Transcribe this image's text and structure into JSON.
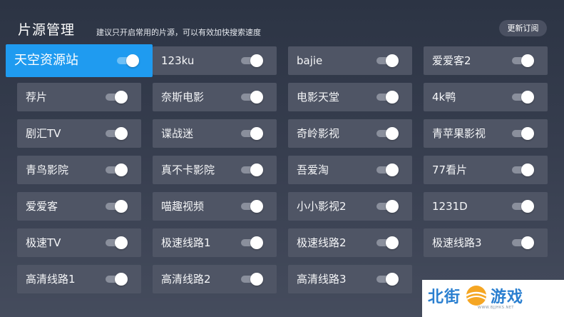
{
  "header": {
    "title": "片源管理",
    "hint": "建议只开启常用的片源，可以有效加快搜索速度",
    "refresh_label": "更新订阅"
  },
  "sources": [
    {
      "label": "天空资源站",
      "enabled": true,
      "focused": true
    },
    {
      "label": "123ku",
      "enabled": true
    },
    {
      "label": "bajie",
      "enabled": true
    },
    {
      "label": "爱爱客2",
      "enabled": true
    },
    {
      "label": "荐片",
      "enabled": true
    },
    {
      "label": "奈斯电影",
      "enabled": true
    },
    {
      "label": "电影天堂",
      "enabled": true
    },
    {
      "label": "4k鸭",
      "enabled": true
    },
    {
      "label": "剧汇TV",
      "enabled": true
    },
    {
      "label": "谍战迷",
      "enabled": true
    },
    {
      "label": "奇岭影视",
      "enabled": true
    },
    {
      "label": "青苹果影视",
      "enabled": true
    },
    {
      "label": "青鸟影院",
      "enabled": true
    },
    {
      "label": "真不卡影院",
      "enabled": true
    },
    {
      "label": "吾爱淘",
      "enabled": true
    },
    {
      "label": "77看片",
      "enabled": true
    },
    {
      "label": "爱爱客",
      "enabled": true
    },
    {
      "label": "喵趣视频",
      "enabled": true
    },
    {
      "label": "小小影视2",
      "enabled": true
    },
    {
      "label": "1231D",
      "enabled": true
    },
    {
      "label": "极速TV",
      "enabled": true
    },
    {
      "label": "极速线路1",
      "enabled": true
    },
    {
      "label": "极速线路2",
      "enabled": true
    },
    {
      "label": "极速线路3",
      "enabled": true
    },
    {
      "label": "高清线路1",
      "enabled": true
    },
    {
      "label": "高清线路2",
      "enabled": true
    },
    {
      "label": "高清线路3",
      "enabled": true
    }
  ],
  "watermark": {
    "name_part1": "北街",
    "name_part2": "游戏",
    "url": "WWW.BJJHKS.NET"
  },
  "colors": {
    "accent": "#1f9bf0",
    "card": "#4f5565",
    "watermark_blue": "#2a7fd0",
    "watermark_orange": "#f08a1e"
  }
}
